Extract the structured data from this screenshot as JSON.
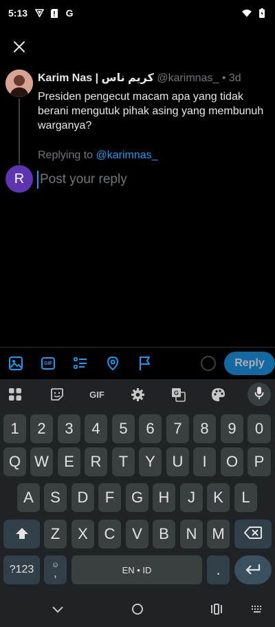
{
  "status_bar": {
    "time": "5:13",
    "left_icons": [
      "vpn-icon",
      "sim-alert-icon",
      "google-icon"
    ],
    "right_icons": [
      "wifi-icon",
      "battery-icon"
    ]
  },
  "header": {
    "close_icon": "close-icon"
  },
  "tweet": {
    "author_name": "Karim Nas | كريم ناس",
    "handle": "@karimnas_",
    "age": " • 3d",
    "text": "Presiden pengecut macam apa yang tidak berani mengutuk pihak asing yang membunuh warganya?",
    "replying_prefix": "Replying to ",
    "replying_handle": "@karimnas_"
  },
  "composer": {
    "avatar_initial": "R",
    "placeholder": "Post your reply",
    "value": ""
  },
  "compose_toolbar": {
    "icons": [
      "image-icon",
      "gif-icon",
      "poll-icon",
      "location-icon",
      "flag-icon"
    ],
    "gif_label": "GIF",
    "reply_label": "Reply"
  },
  "keyboard": {
    "toolbar_gif": "GIF",
    "row_numbers": [
      "1",
      "2",
      "3",
      "4",
      "5",
      "6",
      "7",
      "8",
      "9",
      "0"
    ],
    "row_1": [
      "Q",
      "W",
      "E",
      "R",
      "T",
      "Y",
      "U",
      "I",
      "O",
      "P"
    ],
    "row_2": [
      "A",
      "S",
      "D",
      "F",
      "G",
      "H",
      "J",
      "K",
      "L"
    ],
    "row_3": [
      "Z",
      "X",
      "C",
      "V",
      "B",
      "N",
      "M"
    ],
    "symbols_label": "?123",
    "comma_label": ",",
    "space_label": "EN • ID",
    "period_label": "."
  },
  "colors": {
    "accent": "#1d9bf0",
    "reply_button": "#1a8cd8",
    "avatar_me": "#5e35b1",
    "keyboard_bg": "#1f2326"
  }
}
